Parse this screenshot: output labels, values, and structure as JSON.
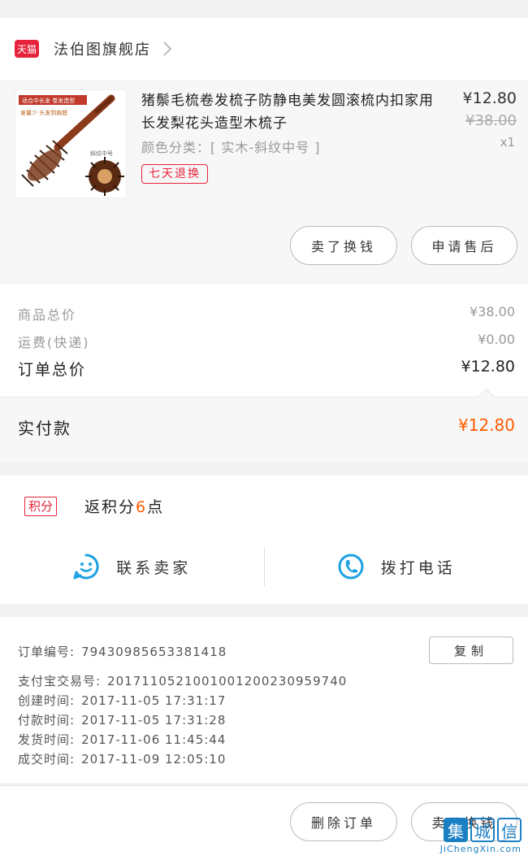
{
  "store": {
    "badge": "天猫",
    "name": "法伯图旗舰店"
  },
  "product": {
    "title": "猪鬃毛梳卷发梳子防静电美发圆滚梳内扣家用长发梨花头造型木梳子",
    "variant": "颜色分类：[ 实木-斜纹中号 ]",
    "tag": "七天退换",
    "price_now": "¥12.80",
    "price_orig": "¥38.00",
    "qty": "x1",
    "image_text": {
      "banner": "适合中长发  卷发造型",
      "sub": "发量少 头发到肩膀",
      "label": "斜纹中号"
    },
    "buttons": {
      "exchange": "卖了换钱",
      "after_sale": "申请售后"
    }
  },
  "totals": {
    "goods_label": "商品总价",
    "goods_value": "¥38.00",
    "shipping_label": "运费(快递)",
    "shipping_value": "¥0.00",
    "order_label": "订单总价",
    "order_value": "¥12.80",
    "paid_label": "实付款",
    "paid_value": "¥12.80"
  },
  "points": {
    "badge": "积分",
    "prefix": "返积分",
    "value": "6",
    "suffix": "点"
  },
  "contact": {
    "seller": "联系卖家",
    "call": "拨打电话"
  },
  "order_info": {
    "order_no_label": "订单编号:",
    "order_no": "79430985653381418",
    "alipay_label": "支付宝交易号:",
    "alipay_no": "2017110521001001200230959740",
    "created_label": "创建时间:",
    "created": "2017-11-05  17:31:17",
    "paid_label": "付款时间:",
    "paid": "2017-11-05  17:31:28",
    "shipped_label": "发货时间:",
    "shipped": "2017-11-06  11:45:44",
    "done_label": "成交时间:",
    "done": "2017-11-09  12:05:10",
    "copy_label": "复制"
  },
  "bottom": {
    "delete_label": "删除订单",
    "exchange_label": "卖了换钱"
  },
  "watermark": {
    "chars": [
      "集",
      "城",
      "信"
    ],
    "url": "JiChengXin.com"
  },
  "colors": {
    "tmall_red": "#e7233b",
    "price_orange": "#ff5a00",
    "icon_blue": "#1da1e2",
    "watermark_blue": "#1a7fc3"
  }
}
